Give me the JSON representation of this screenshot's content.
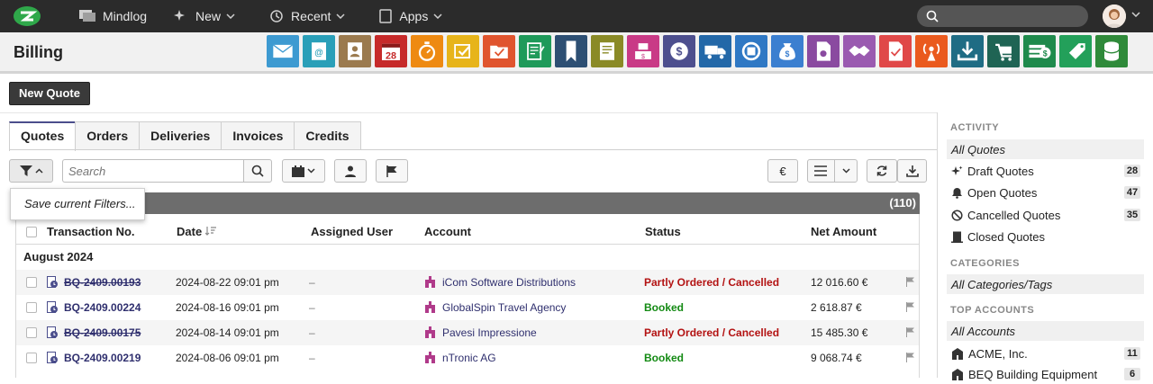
{
  "topnav": {
    "app_name": "Mindlog",
    "new_label": "New",
    "recent_label": "Recent",
    "apps_label": "Apps"
  },
  "page": {
    "title": "Billing",
    "new_quote_label": "New Quote"
  },
  "app_icons": [
    {
      "name": "mail-icon",
      "color": "#3d9ad1"
    },
    {
      "name": "email-contact-icon",
      "color": "#2a9fb8"
    },
    {
      "name": "address-book-icon",
      "color": "#9b7a4e"
    },
    {
      "name": "calendar-icon",
      "color": "#c62a2a",
      "text": "28"
    },
    {
      "name": "stopwatch-icon",
      "color": "#ee8a12"
    },
    {
      "name": "tasks-icon",
      "color": "#e7b41a"
    },
    {
      "name": "folder-check-icon",
      "color": "#e0542e"
    },
    {
      "name": "notes-icon",
      "color": "#1f9a5a"
    },
    {
      "name": "bookmark-icon",
      "color": "#2d4f73"
    },
    {
      "name": "contract-icon",
      "color": "#8a8a26"
    },
    {
      "name": "point-of-sale-icon",
      "color": "#c93a86"
    },
    {
      "name": "dollar-icon",
      "color": "#4d4f8e"
    },
    {
      "name": "truck-icon",
      "color": "#2368a8"
    },
    {
      "name": "recycle-icon",
      "color": "#2f78c4"
    },
    {
      "name": "money-bag-icon",
      "color": "#3b7fd0"
    },
    {
      "name": "document-stamp-icon",
      "color": "#8a4aa0"
    },
    {
      "name": "handshake-icon",
      "color": "#9a5ab0"
    },
    {
      "name": "document-check-icon",
      "color": "#e04848"
    },
    {
      "name": "broadcast-icon",
      "color": "#ea5a1e"
    },
    {
      "name": "download-icon",
      "color": "#1f6c84"
    },
    {
      "name": "cart-icon",
      "color": "#1f6454"
    },
    {
      "name": "cash-icon",
      "color": "#1f8a4c"
    },
    {
      "name": "price-tag-icon",
      "color": "#23a05a"
    },
    {
      "name": "database-icon",
      "color": "#2f8a3a"
    }
  ],
  "tabs": [
    "Quotes",
    "Orders",
    "Deliveries",
    "Invoices",
    "Credits"
  ],
  "toolbar": {
    "search_placeholder": "Search",
    "euro_label": "€"
  },
  "filter_menu": {
    "save_filters": "Save current Filters..."
  },
  "grid": {
    "count": "(110)",
    "columns": {
      "transaction": "Transaction No.",
      "date": "Date",
      "user": "Assigned User",
      "account": "Account",
      "status": "Status",
      "amount": "Net Amount"
    },
    "group": "August 2024",
    "rows": [
      {
        "txn": "BQ-2409.00193",
        "date": "2024-08-22 09:01 pm",
        "user": "–",
        "account": "iCom Software Distributions",
        "status": "Partly Ordered / Cancelled",
        "status_color": "#b31212",
        "amount": "12 016.60 €"
      },
      {
        "txn": "BQ-2409.00224",
        "date": "2024-08-16 09:01 pm",
        "user": "–",
        "account": "GlobalSpin Travel Agency",
        "status": "Booked",
        "status_color": "#138a13",
        "amount": "2 618.87 €"
      },
      {
        "txn": "BQ-2409.00175",
        "date": "2024-08-14 09:01 pm",
        "user": "–",
        "account": "Pavesi Impressione",
        "status": "Partly Ordered / Cancelled",
        "status_color": "#b31212",
        "amount": "15 485.30 €"
      },
      {
        "txn": "BQ-2409.00219",
        "date": "2024-08-06 09:01 pm",
        "user": "–",
        "account": "nTronic AG",
        "status": "Booked",
        "status_color": "#138a13",
        "amount": "9 068.74 €"
      }
    ]
  },
  "sidebar": {
    "activity_title": "ACTIVITY",
    "all_quotes": "All Quotes",
    "draft": {
      "label": "Draft Quotes",
      "count": "28"
    },
    "open": {
      "label": "Open Quotes",
      "count": "47"
    },
    "cancelled": {
      "label": "Cancelled Quotes",
      "count": "35"
    },
    "closed": {
      "label": "Closed Quotes"
    },
    "categories_title": "CATEGORIES",
    "all_categories": "All Categories/Tags",
    "accounts_title": "TOP ACCOUNTS",
    "all_accounts": "All Accounts",
    "acme": {
      "label": "ACME, Inc.",
      "count": "11"
    },
    "beq": {
      "label": "BEQ Building Equipment",
      "count": "6"
    }
  }
}
